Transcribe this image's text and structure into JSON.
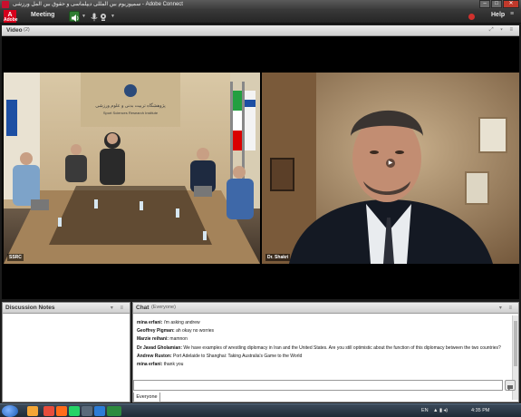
{
  "window": {
    "title": "ﺳﻤﭙﻮزﯾﻮم ﺑﯿﻦ اﻟﻤﻠﻠﯽ دﯾﭙﻠﻤﺎﺳﯽ و ﺣﻘﻮق ﺑﯿﻦ اﻟﻤﻞ ورزﺷﯽ - Adobe Connect"
  },
  "menubar": {
    "logo_line1": "Adobe",
    "logo_line2": "A",
    "meeting_label": "Meeting",
    "help_label": "Help",
    "more_label": "≡",
    "colors": {
      "record": "#d0312d",
      "speaker": "#2f7d32"
    }
  },
  "video_pod": {
    "title": "Video",
    "count": "(2)",
    "feeds": [
      {
        "label": "SSRC"
      },
      {
        "label": "Dr. Shakri"
      }
    ],
    "room_sign": "پژوهشگاه تربیت بدنی و علوم ورزشی",
    "room_sign_en": "Sport Sciences Research Institute"
  },
  "notes_pod": {
    "title": "Discussion Notes"
  },
  "chat_pod": {
    "title": "Chat",
    "scope": "(Everyone)",
    "messages": [
      {
        "sender": "mina erfani:",
        "text": "i'm asking andrew"
      },
      {
        "sender": "Geoffrey Pigman:",
        "text": "ah okay no worries"
      },
      {
        "sender": "Marzie reihani:",
        "text": "mamnon"
      },
      {
        "sender": "Dr Javad Gholamian:",
        "text": "We have examples of wrestling diplomacy in Iran and the United States. Are you still optimistic about the function of this diplomacy between the two countries?"
      },
      {
        "sender": "Andrew Ruston:",
        "text": "Port Adelaide to Shanghai: Taking Australia's Game to the World"
      },
      {
        "sender": "mina erfani:",
        "text": "thank you"
      }
    ],
    "tab_label": "Everyone"
  },
  "taskbar": {
    "language": "EN",
    "time": "4:35 PM"
  }
}
